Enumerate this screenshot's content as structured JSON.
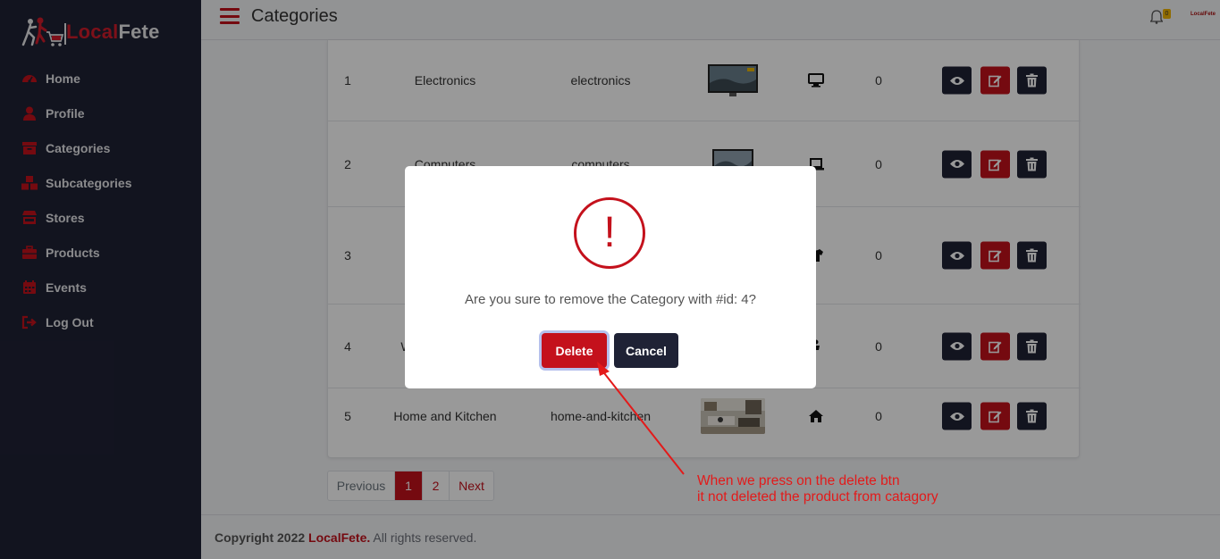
{
  "app": {
    "logo_local": "Local",
    "logo_fete": "Fete",
    "header_brand_small": "LocalFete",
    "page_title": "Categories",
    "notification_count": "0"
  },
  "sidebar": {
    "items": [
      {
        "label": "Home",
        "icon": "dashboard-icon"
      },
      {
        "label": "Profile",
        "icon": "user-icon"
      },
      {
        "label": "Categories",
        "icon": "archive-icon"
      },
      {
        "label": "Subcategories",
        "icon": "boxes-icon"
      },
      {
        "label": "Stores",
        "icon": "store-icon"
      },
      {
        "label": "Products",
        "icon": "briefcase-icon"
      },
      {
        "label": "Events",
        "icon": "calendar-icon"
      },
      {
        "label": "Log Out",
        "icon": "logout-icon"
      }
    ]
  },
  "table": {
    "rows": [
      {
        "id": "1",
        "name": "Electronics",
        "slug": "electronics",
        "icon": "desktop-icon",
        "count": "0"
      },
      {
        "id": "2",
        "name": "Computers",
        "slug": "computers",
        "icon": "laptop-icon",
        "count": "0"
      },
      {
        "id": "3",
        "name": "",
        "slug": "",
        "icon": "tshirt-icon",
        "count": "0"
      },
      {
        "id": "4",
        "name": "W",
        "slug": "",
        "icon": "baby-icon",
        "count": "0"
      },
      {
        "id": "5",
        "name": "Home and Kitchen",
        "slug": "home-and-kitchen",
        "icon": "home-icon",
        "count": "0"
      }
    ]
  },
  "pagination": {
    "previous": "Previous",
    "pages": [
      "1",
      "2"
    ],
    "next": "Next",
    "active_page": "1"
  },
  "footer": {
    "copyright": "Copyright 2022",
    "brand": "LocalFete.",
    "rights": "All rights reserved."
  },
  "modal": {
    "icon_glyph": "!",
    "message": "Are you sure to remove the Category with #id: 4?",
    "delete_label": "Delete",
    "cancel_label": "Cancel"
  },
  "annotation": {
    "line1": "When we press on the delete btn",
    "line2": "it not deleted the product from catagory"
  },
  "colors": {
    "brand_red": "#c4111c",
    "sidebar_bg": "#1f2235",
    "annotation_red": "#e31a1a"
  }
}
